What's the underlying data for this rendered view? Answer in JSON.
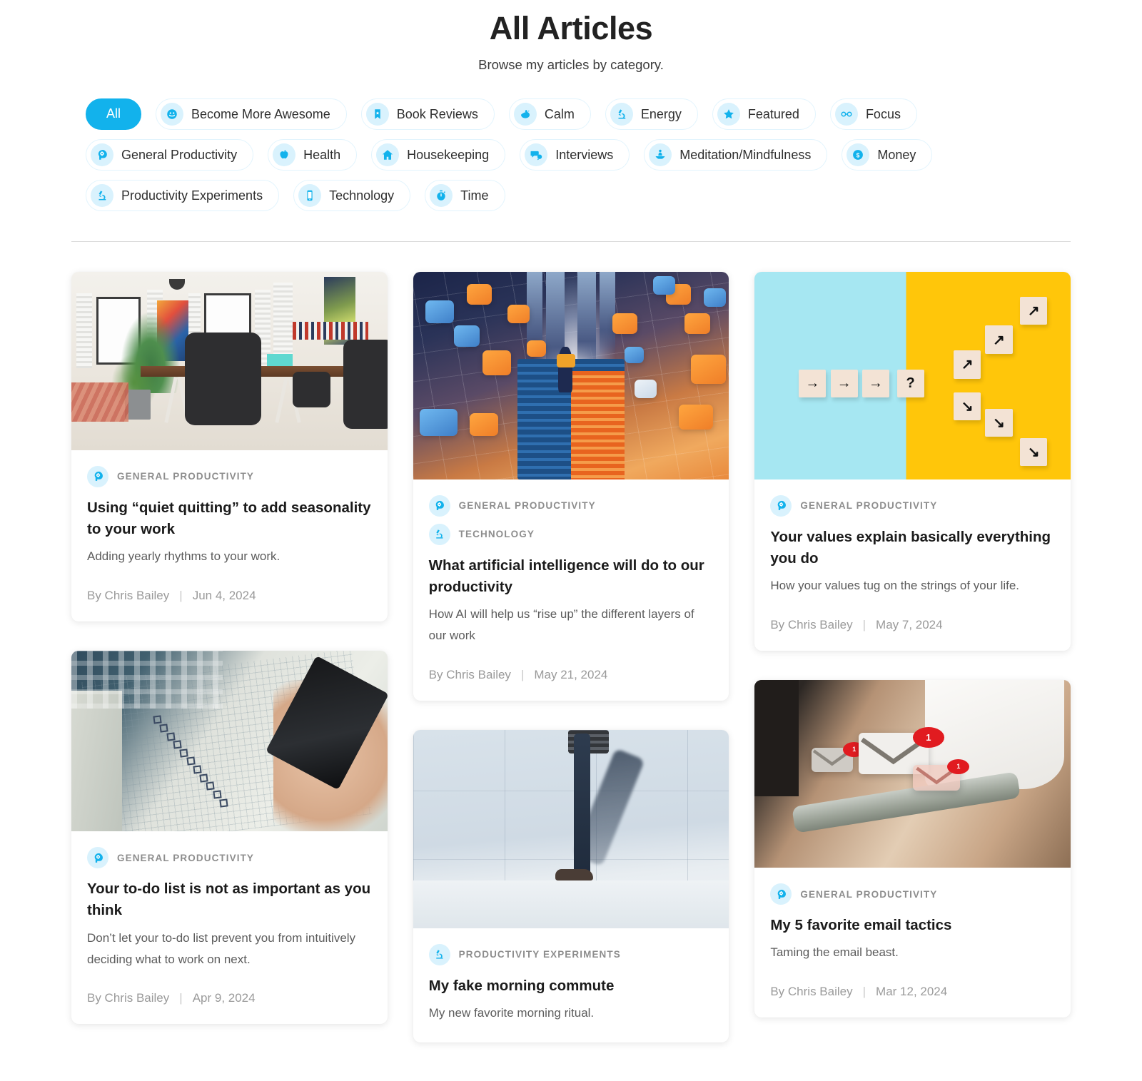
{
  "header": {
    "title": "All Articles",
    "subtitle": "Browse my articles by category."
  },
  "filters": {
    "all_label": "All",
    "items": [
      {
        "label": "Become More Awesome",
        "icon": "smiley-icon"
      },
      {
        "label": "Book Reviews",
        "icon": "bookmark-icon"
      },
      {
        "label": "Calm",
        "icon": "duck-icon"
      },
      {
        "label": "Energy",
        "icon": "microscope-icon"
      },
      {
        "label": "Featured",
        "icon": "star-icon"
      },
      {
        "label": "Focus",
        "icon": "glasses-icon"
      },
      {
        "label": "General Productivity",
        "icon": "head-gear-icon"
      },
      {
        "label": "Health",
        "icon": "apple-icon"
      },
      {
        "label": "Housekeeping",
        "icon": "house-icon"
      },
      {
        "label": "Interviews",
        "icon": "speech-bubbles-icon"
      },
      {
        "label": "Meditation/Mindfulness",
        "icon": "meditation-icon"
      },
      {
        "label": "Money",
        "icon": "dollar-coin-icon"
      },
      {
        "label": "Productivity Experiments",
        "icon": "microscope-icon"
      },
      {
        "label": "Technology",
        "icon": "smartphone-icon"
      },
      {
        "label": "Time",
        "icon": "stopwatch-icon"
      }
    ]
  },
  "colors": {
    "accent": "#12b2ec",
    "icon_badge_bg": "#d9f2fd",
    "chip_border": "#e2f4fd",
    "category_text": "#8d8d8d",
    "meta_text": "#9a9a9a"
  },
  "articles": [
    {
      "id": "quiet-quitting",
      "column": 1,
      "image": "office-workspace-photo",
      "categories": [
        {
          "name": "General Productivity",
          "icon": "head-gear-icon"
        }
      ],
      "title": "Using “quiet quitting” to add seasonality to your work",
      "excerpt": "Adding yearly rhythms to your work.",
      "author": "By Chris Bailey",
      "separator": "|",
      "date": "Jun 4, 2024"
    },
    {
      "id": "todo-list",
      "column": 1,
      "image": "handwritten-checklist-photo",
      "categories": [
        {
          "name": "General Productivity",
          "icon": "head-gear-icon"
        }
      ],
      "title": "Your to-do list is not as important as you think",
      "excerpt": "Don’t let your to-do list prevent you from intuitively deciding what to work on next.",
      "author": "By Chris Bailey",
      "separator": "|",
      "date": "Apr 9, 2024"
    },
    {
      "id": "artificial-intelligence",
      "column": 2,
      "image": "ai-city-books-illustration",
      "categories": [
        {
          "name": "General Productivity",
          "icon": "head-gear-icon"
        },
        {
          "name": "Technology",
          "icon": "microscope-icon"
        }
      ],
      "title": "What artificial intelligence will do to our productivity",
      "excerpt": "How AI will help us “rise up” the different layers of our work",
      "author": "By Chris Bailey",
      "separator": "|",
      "date": "May 21, 2024"
    },
    {
      "id": "fake-morning-commute",
      "column": 2,
      "image": "person-walking-photo",
      "categories": [
        {
          "name": "Productivity Experiments",
          "icon": "microscope-icon"
        }
      ],
      "title": "My fake morning commute",
      "excerpt": "My new favorite morning ritual.",
      "author": "",
      "separator": "",
      "date": ""
    },
    {
      "id": "your-values",
      "column": 3,
      "image": "arrow-blocks-photo",
      "categories": [
        {
          "name": "General Productivity",
          "icon": "head-gear-icon"
        }
      ],
      "title": "Your values explain basically everything you do",
      "excerpt": "How your values tug on the strings of your life.",
      "author": "By Chris Bailey",
      "separator": "|",
      "date": "May 7, 2024"
    },
    {
      "id": "email-tactics",
      "column": 3,
      "image": "phone-email-notifications-photo",
      "categories": [
        {
          "name": "General Productivity",
          "icon": "head-gear-icon"
        }
      ],
      "title": "My 5 favorite email tactics",
      "excerpt": "Taming the email beast.",
      "author": "By Chris Bailey",
      "separator": "|",
      "date": "Mar 12, 2024"
    }
  ],
  "blocks_image": {
    "left_symbols": [
      "→",
      "→",
      "→",
      "?"
    ],
    "right_symbols": [
      "↗",
      "↗",
      "↗",
      "↘",
      "↘",
      "↘"
    ]
  },
  "mail_image": {
    "badge_counts": [
      "1",
      "1",
      "1"
    ]
  }
}
